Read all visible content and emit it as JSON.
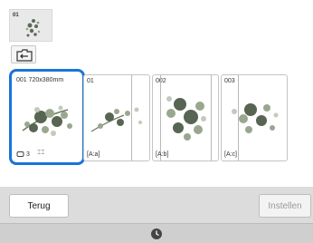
{
  "top_thumbnail": {
    "number": "01",
    "icon": "embroidery-pattern-icon"
  },
  "back_folder": {
    "icon": "folder-return-icon"
  },
  "cards": [
    {
      "label": "001 720x380mm",
      "hoop_count": "3",
      "selected": true
    },
    {
      "label": "01",
      "part": "[A:a]"
    },
    {
      "label": "002",
      "part": "[A:b]"
    },
    {
      "label": "003",
      "part": "[A:c]"
    }
  ],
  "buttons": {
    "back": "Terug",
    "set": "Instellen"
  },
  "colors": {
    "selection": "#1a74d8"
  }
}
